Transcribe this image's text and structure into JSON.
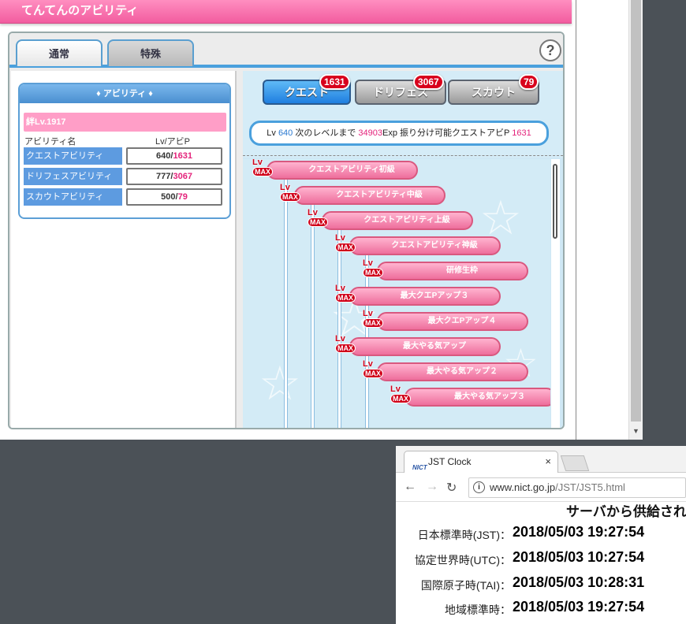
{
  "game": {
    "title": "てんてんのアビリティ",
    "tabs": [
      "通常",
      "特殊"
    ],
    "help_label": "?",
    "ability_box": {
      "header": "♦ アビリティ ♦",
      "bond_level": "絆Lv.1917",
      "col_name": "アビリティ名",
      "col_value": "Lv/アビP",
      "rows": [
        {
          "name": "クエストアビリティ",
          "lv": "640",
          "ap": "1631"
        },
        {
          "name": "ドリフェスアビリティ",
          "lv": "777",
          "ap": "3067"
        },
        {
          "name": "スカウトアビリティ",
          "lv": "500",
          "ap": "79"
        }
      ]
    },
    "segments": [
      {
        "label": "クエスト",
        "badge": "1631"
      },
      {
        "label": "ドリフェス",
        "badge": "3067"
      },
      {
        "label": "スカウト",
        "badge": "79"
      }
    ],
    "info": {
      "lv_label": "Lv",
      "lv_value": "640",
      "next_label": "次のレベルまで",
      "next_value": "34903",
      "exp_unit": "Exp",
      "alloc_label": "振り分け可能クエストアビP",
      "alloc_value": "1631"
    },
    "lv_badge": {
      "lv": "Lv",
      "max": "MAX"
    },
    "tree_nodes": [
      "クエストアビリティ初級",
      "クエストアビリティ中級",
      "クエストアビリティ上級",
      "クエストアビリティ神級",
      "研修生枠",
      "最大クエPアップ３",
      "最大クエPアップ４",
      "最大やる気アップ",
      "最大やる気アップ２",
      "最大やる気アップ３"
    ]
  },
  "browser": {
    "tab_title": "JST Clock",
    "favicon": "NICT",
    "tab_close": "×",
    "url_host": "www.nict.go.jp",
    "url_path": "/JST/JST5.html",
    "heading": "サーバから供給され",
    "rows": [
      {
        "label": "日本標準時(JST)：",
        "value": "2018/05/03 19:27:54"
      },
      {
        "label": "協定世界時(UTC)：",
        "value": "2018/05/03 10:27:54"
      },
      {
        "label": "国際原子時(TAI)：",
        "value": "2018/05/03 10:28:31"
      },
      {
        "label": "地域標準時：",
        "value": "2018/05/03 19:27:54"
      }
    ]
  },
  "colors": {
    "pink_accent": "#e4237b",
    "blue_accent": "#2b7ad1",
    "title_pink": "#f25c9f",
    "badge_red": "#d8001c"
  }
}
